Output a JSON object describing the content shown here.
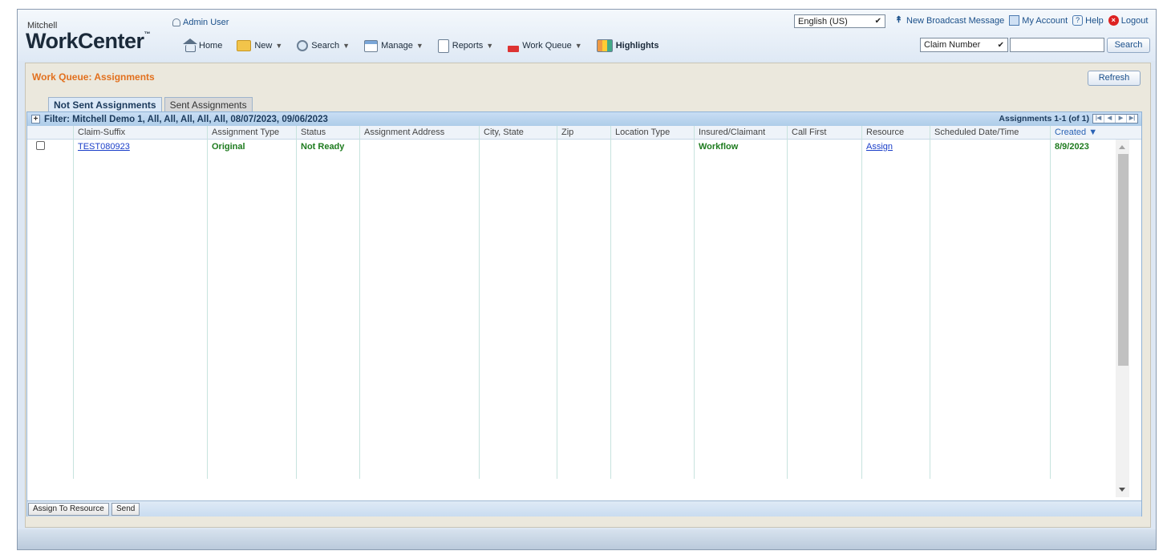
{
  "header": {
    "brand_small": "Mitchell",
    "brand_big": "WorkCenter",
    "brand_tm": "™",
    "user": "Admin User",
    "language": "English (US)",
    "links": {
      "broadcast": "New Broadcast Message",
      "account": "My Account",
      "help": "Help",
      "logout": "Logout"
    },
    "nav": {
      "home": "Home",
      "new": "New",
      "search": "Search",
      "manage": "Manage",
      "reports": "Reports",
      "work_queue": "Work Queue",
      "highlights": "Highlights"
    },
    "search_field": "Claim Number",
    "search_value": "",
    "search_button": "Search"
  },
  "page": {
    "title": "Work Queue: Assignments",
    "refresh": "Refresh",
    "tabs": [
      "Not Sent Assignments",
      "Sent Assignments"
    ],
    "active_tab": 0
  },
  "grid": {
    "filter": "Filter: Mitchell Demo 1, All, All, All, All, All, 08/07/2023, 09/06/2023",
    "pager": "Assignments 1-1 (of 1)",
    "columns": [
      "Claim-Suffix",
      "Assignment Type",
      "Status",
      "Assignment Address",
      "City, State",
      "Zip",
      "Location Type",
      "Insured/Claimant",
      "Call First",
      "Resource",
      "Scheduled Date/Time",
      "Created ▼"
    ],
    "rows": [
      {
        "claim_suffix": "TEST080923",
        "assignment_type": "Original",
        "status": "Not Ready",
        "address": "",
        "city_state": "",
        "zip": "",
        "location_type": "",
        "insured": "Workflow",
        "call_first": "",
        "resource": "Assign",
        "scheduled": "",
        "created": "8/9/2023"
      }
    ]
  },
  "footer": {
    "assign_to_resource": "Assign To Resource",
    "send": "Send"
  },
  "colors": {
    "title_orange": "#e2701e",
    "status_green": "#1e7b1e",
    "link_blue": "#1b3fc9"
  }
}
